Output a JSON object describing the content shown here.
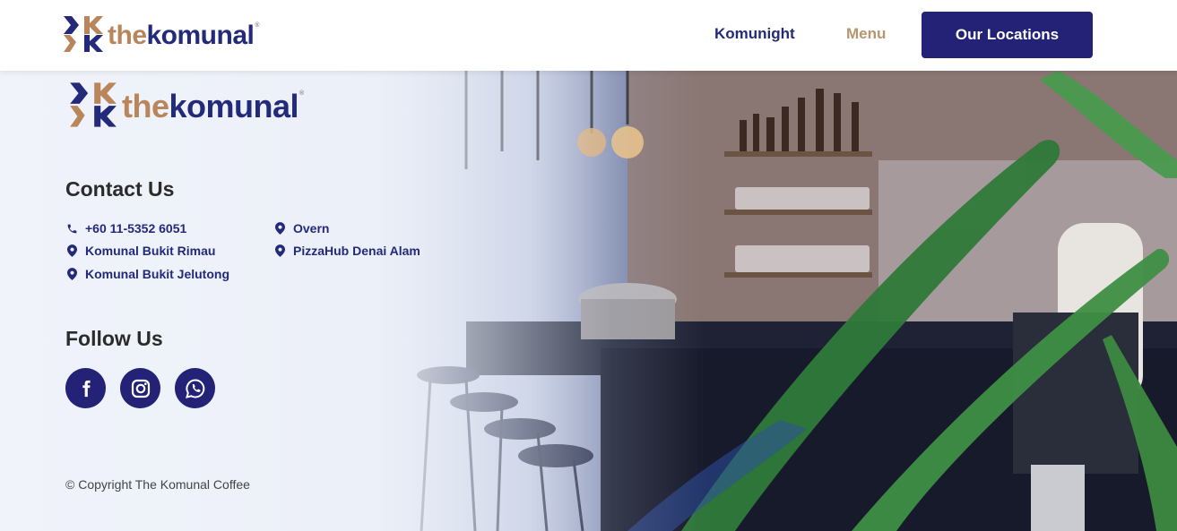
{
  "header": {
    "logo": {
      "prefix": "the",
      "name": "komunal",
      "reg": "®"
    },
    "nav": {
      "komunight": "Komunight",
      "menu": "Menu",
      "locations_button": "Our Locations"
    }
  },
  "footer": {
    "logo": {
      "prefix": "the",
      "name": "komunal",
      "reg": "®"
    },
    "contact": {
      "title": "Contact Us",
      "items": [
        {
          "icon": "phone-icon",
          "label": "+60 11-5352 6051"
        },
        {
          "icon": "map-pin-icon",
          "label": "Komunal Bukit Rimau"
        },
        {
          "icon": "map-pin-icon",
          "label": "Komunal Bukit Jelutong"
        },
        {
          "icon": "map-pin-icon",
          "label": "Overn"
        },
        {
          "icon": "map-pin-icon",
          "label": "PizzaHub Denai Alam"
        }
      ]
    },
    "follow": {
      "title": "Follow Us",
      "socials": [
        {
          "icon": "facebook-icon"
        },
        {
          "icon": "instagram-icon"
        },
        {
          "icon": "whatsapp-icon"
        }
      ]
    },
    "copyright": "© Copyright The Komunal Coffee"
  },
  "colors": {
    "brand_navy": "#232276",
    "brand_gold": "#b8865a",
    "menu_gold": "#b8956e"
  }
}
